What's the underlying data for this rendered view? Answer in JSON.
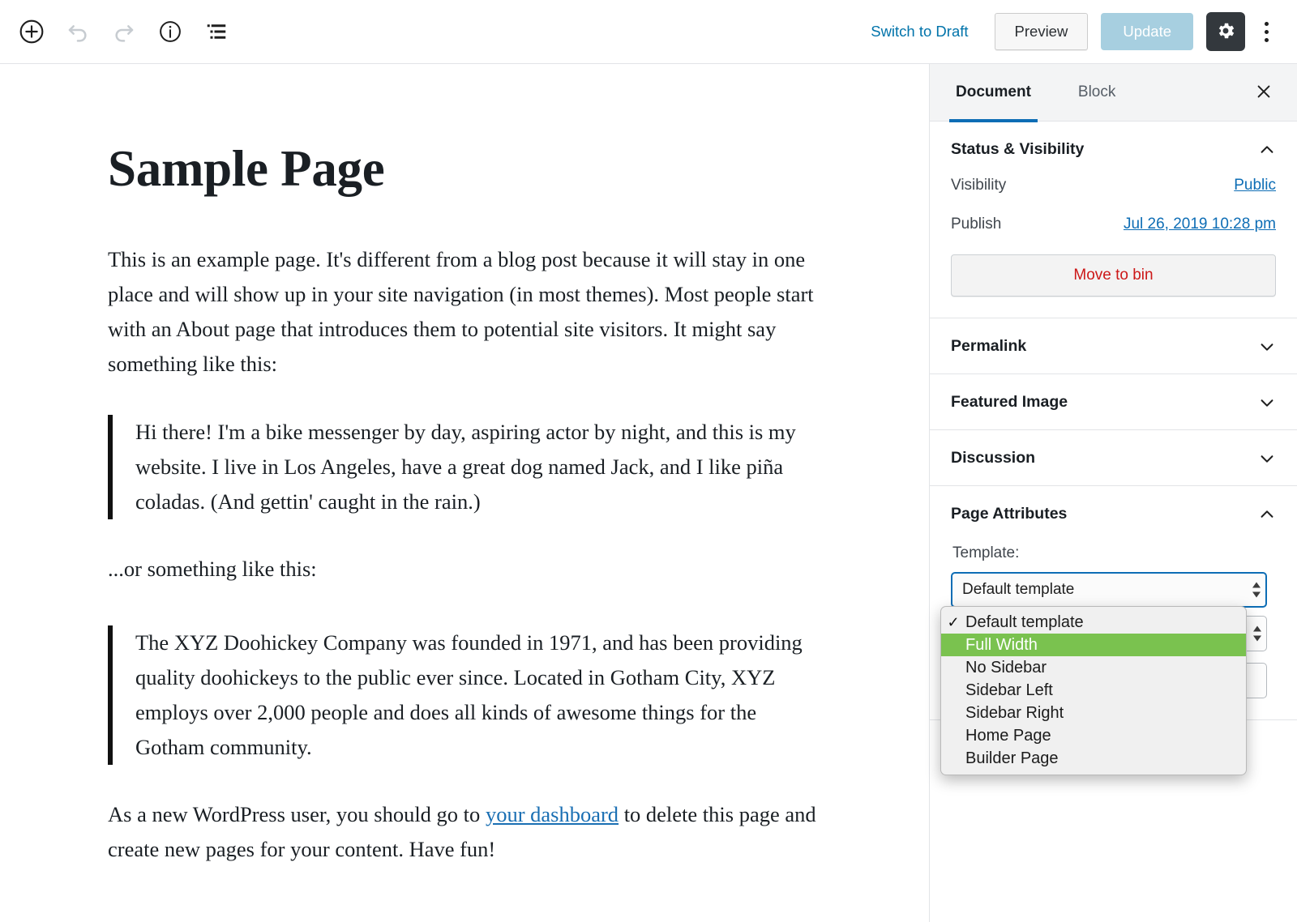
{
  "toolbar": {
    "left_icons": [
      {
        "name": "add-block-icon",
        "label": "Add block"
      },
      {
        "name": "undo-icon",
        "label": "Undo"
      },
      {
        "name": "redo-icon",
        "label": "Redo"
      },
      {
        "name": "content-info-icon",
        "label": "Content structure"
      },
      {
        "name": "block-navigation-icon",
        "label": "Block navigation"
      }
    ],
    "switch_to_draft": "Switch to Draft",
    "preview": "Preview",
    "update": "Update",
    "settings_icon": "gear-icon",
    "more_icon": "ellipsis-vertical-icon"
  },
  "editor": {
    "title": "Sample Page",
    "paragraph_1": "This is an example page. It's different from a blog post because it will stay in one place and will show up in your site navigation (in most themes). Most people start with an About page that introduces them to potential site visitors. It might say something like this:",
    "quote_1": "Hi there! I'm a bike messenger by day, aspiring actor by night, and this is my website. I live in Los Angeles, have a great dog named Jack, and I like piña coladas. (And gettin' caught in the rain.)",
    "paragraph_2": "...or something like this:",
    "quote_2": "The XYZ Doohickey Company was founded in 1971, and has been providing quality doohickeys to the public ever since. Located in Gotham City, XYZ employs over 2,000 people and does all kinds of awesome things for the Gotham community.",
    "paragraph_3_before": "As a new WordPress user, you should go to ",
    "paragraph_3_link": "your dashboard",
    "paragraph_3_after": " to delete this page and create new pages for your content. Have fun!"
  },
  "sidebar": {
    "tabs": [
      {
        "label": "Document",
        "active": true
      },
      {
        "label": "Block",
        "active": false
      }
    ],
    "close_label": "Close settings",
    "status": {
      "title": "Status & Visibility",
      "visibility_label": "Visibility",
      "visibility_value": "Public",
      "publish_label": "Publish",
      "publish_value": "Jul 26, 2019 10:28 pm",
      "move_to_bin": "Move to bin"
    },
    "panels": [
      {
        "title": "Permalink",
        "expanded": false
      },
      {
        "title": "Featured Image",
        "expanded": false
      },
      {
        "title": "Discussion",
        "expanded": false
      }
    ],
    "page_attributes": {
      "title": "Page Attributes",
      "template_label": "Template:",
      "template_value": "Default template"
    }
  },
  "template_dropdown": {
    "open": true,
    "selected_value": "Default template",
    "highlighted_value": "Full Width",
    "options": [
      {
        "label": "Default template",
        "checked": true,
        "highlighted": false
      },
      {
        "label": "Full Width",
        "checked": false,
        "highlighted": true
      },
      {
        "label": "No Sidebar",
        "checked": false,
        "highlighted": false
      },
      {
        "label": "Sidebar Left",
        "checked": false,
        "highlighted": false
      },
      {
        "label": "Sidebar Right",
        "checked": false,
        "highlighted": false
      },
      {
        "label": "Home Page",
        "checked": false,
        "highlighted": false
      },
      {
        "label": "Builder Page",
        "checked": false,
        "highlighted": false
      }
    ]
  },
  "colors": {
    "link_blue": "#0073aa",
    "tab_accent": "#0d6db5",
    "update_disabled": "#a7cfe0",
    "gear_dark": "#33383d",
    "danger_red": "#cc1818",
    "highlight_green": "#7ac24f"
  }
}
